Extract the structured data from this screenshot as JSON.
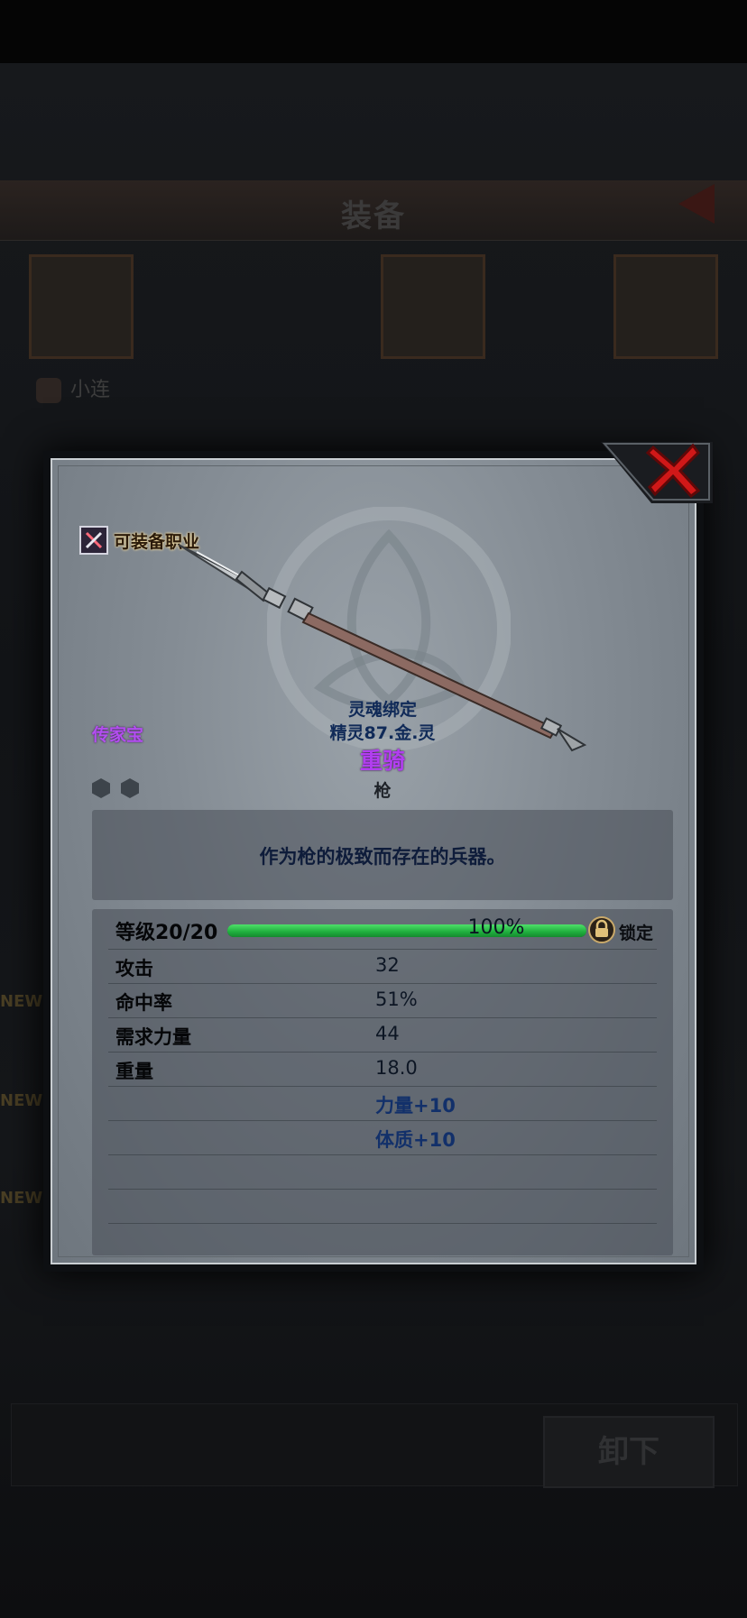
{
  "background": {
    "title": "装备",
    "owner_name": "小连",
    "new_badges": [
      "NEW",
      "NEW",
      "NEW"
    ],
    "unequip_label": "卸下"
  },
  "dialog": {
    "class_label": "可装备职业",
    "quality": "传家宝",
    "binding": "灵魂绑定",
    "maker": "精灵87.金.灵",
    "item_name": "重骑",
    "item_type": "枪",
    "description": "作为枪的极致而存在的兵器。",
    "level": {
      "label": "等级20/20",
      "progress_text": "100%",
      "progress": 1.0,
      "lock_label": "锁定"
    },
    "stats": [
      {
        "label": "攻击",
        "value": "32"
      },
      {
        "label": "命中率",
        "value": "51%"
      },
      {
        "label": "需求力量",
        "value": "44"
      },
      {
        "label": "重量",
        "value": "18.0"
      }
    ],
    "bonuses": [
      "力量+10",
      "体质+10"
    ],
    "sockets": 2
  },
  "colors": {
    "legendary_purple": "#b23ef0",
    "progress_green": "#1fae3d",
    "close_red": "#d01818",
    "bind_blue": "#102a58"
  },
  "icons": {
    "close": "close-x-icon",
    "class": "crossed-weapons-icon",
    "lock": "padlock-icon",
    "socket": "hexagon-socket-icon",
    "item": "spear-icon"
  }
}
